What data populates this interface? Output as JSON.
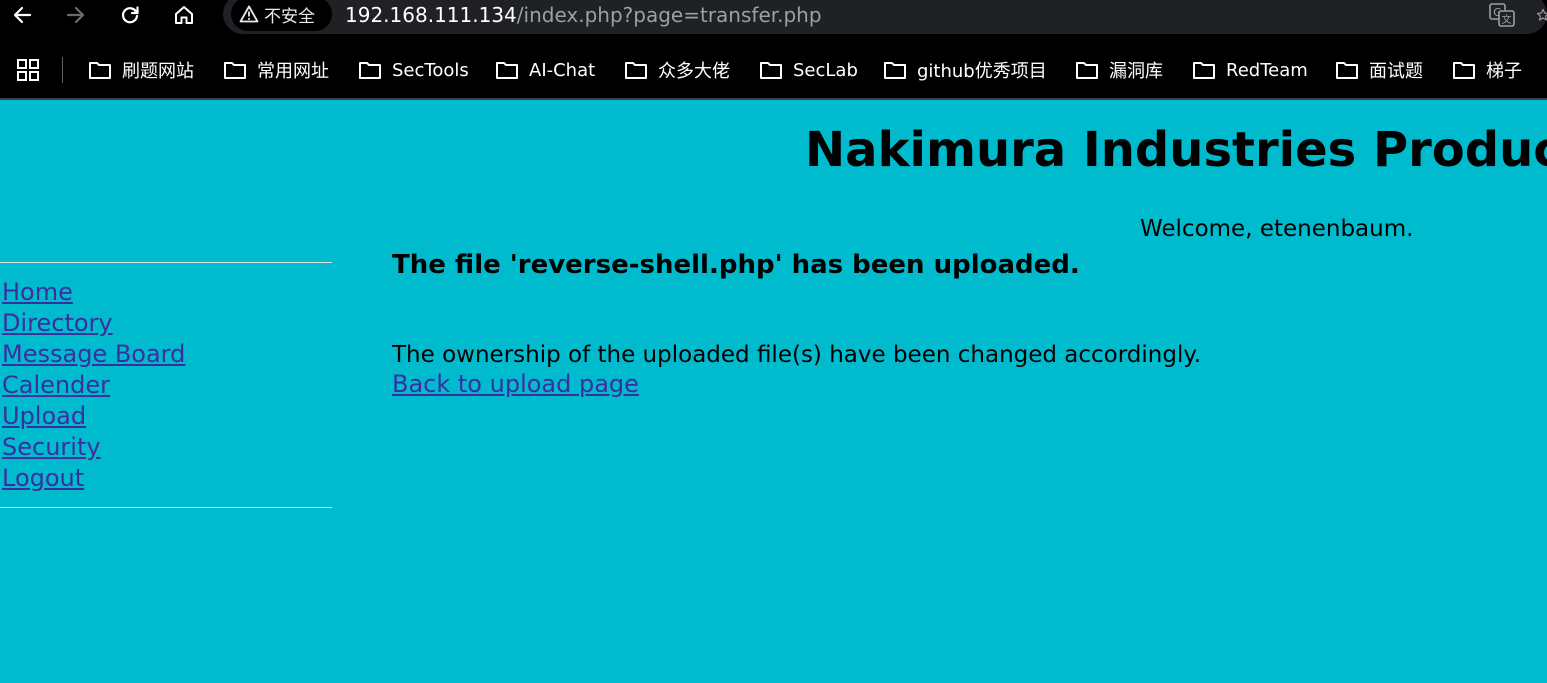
{
  "browser": {
    "security_label": "不安全",
    "url_host": "192.168.111.134",
    "url_path": "/index.php?page=transfer.php",
    "bookmarks": [
      "刷题网站",
      "常用网址",
      "SecTools",
      "AI-Chat",
      "众多大佬",
      "SecLab",
      "github优秀项目",
      "漏洞库",
      "RedTeam",
      "面试题",
      "梯子"
    ]
  },
  "page": {
    "title": "Nakimura Industries Productio",
    "welcome": "Welcome, etenenbaum.",
    "nav": [
      "Home",
      "Directory",
      "Message Board",
      "Calender",
      "Upload",
      "Security",
      "Logout"
    ],
    "upload_message": "The file 'reverse-shell.php' has been uploaded.",
    "ownership_message": "The ownership of the uploaded file(s) have been changed accordingly.",
    "back_link": "Back to upload page"
  },
  "colors": {
    "page_background": "#00bbce",
    "link": "#3b2fa0",
    "chrome_background": "#000000"
  }
}
